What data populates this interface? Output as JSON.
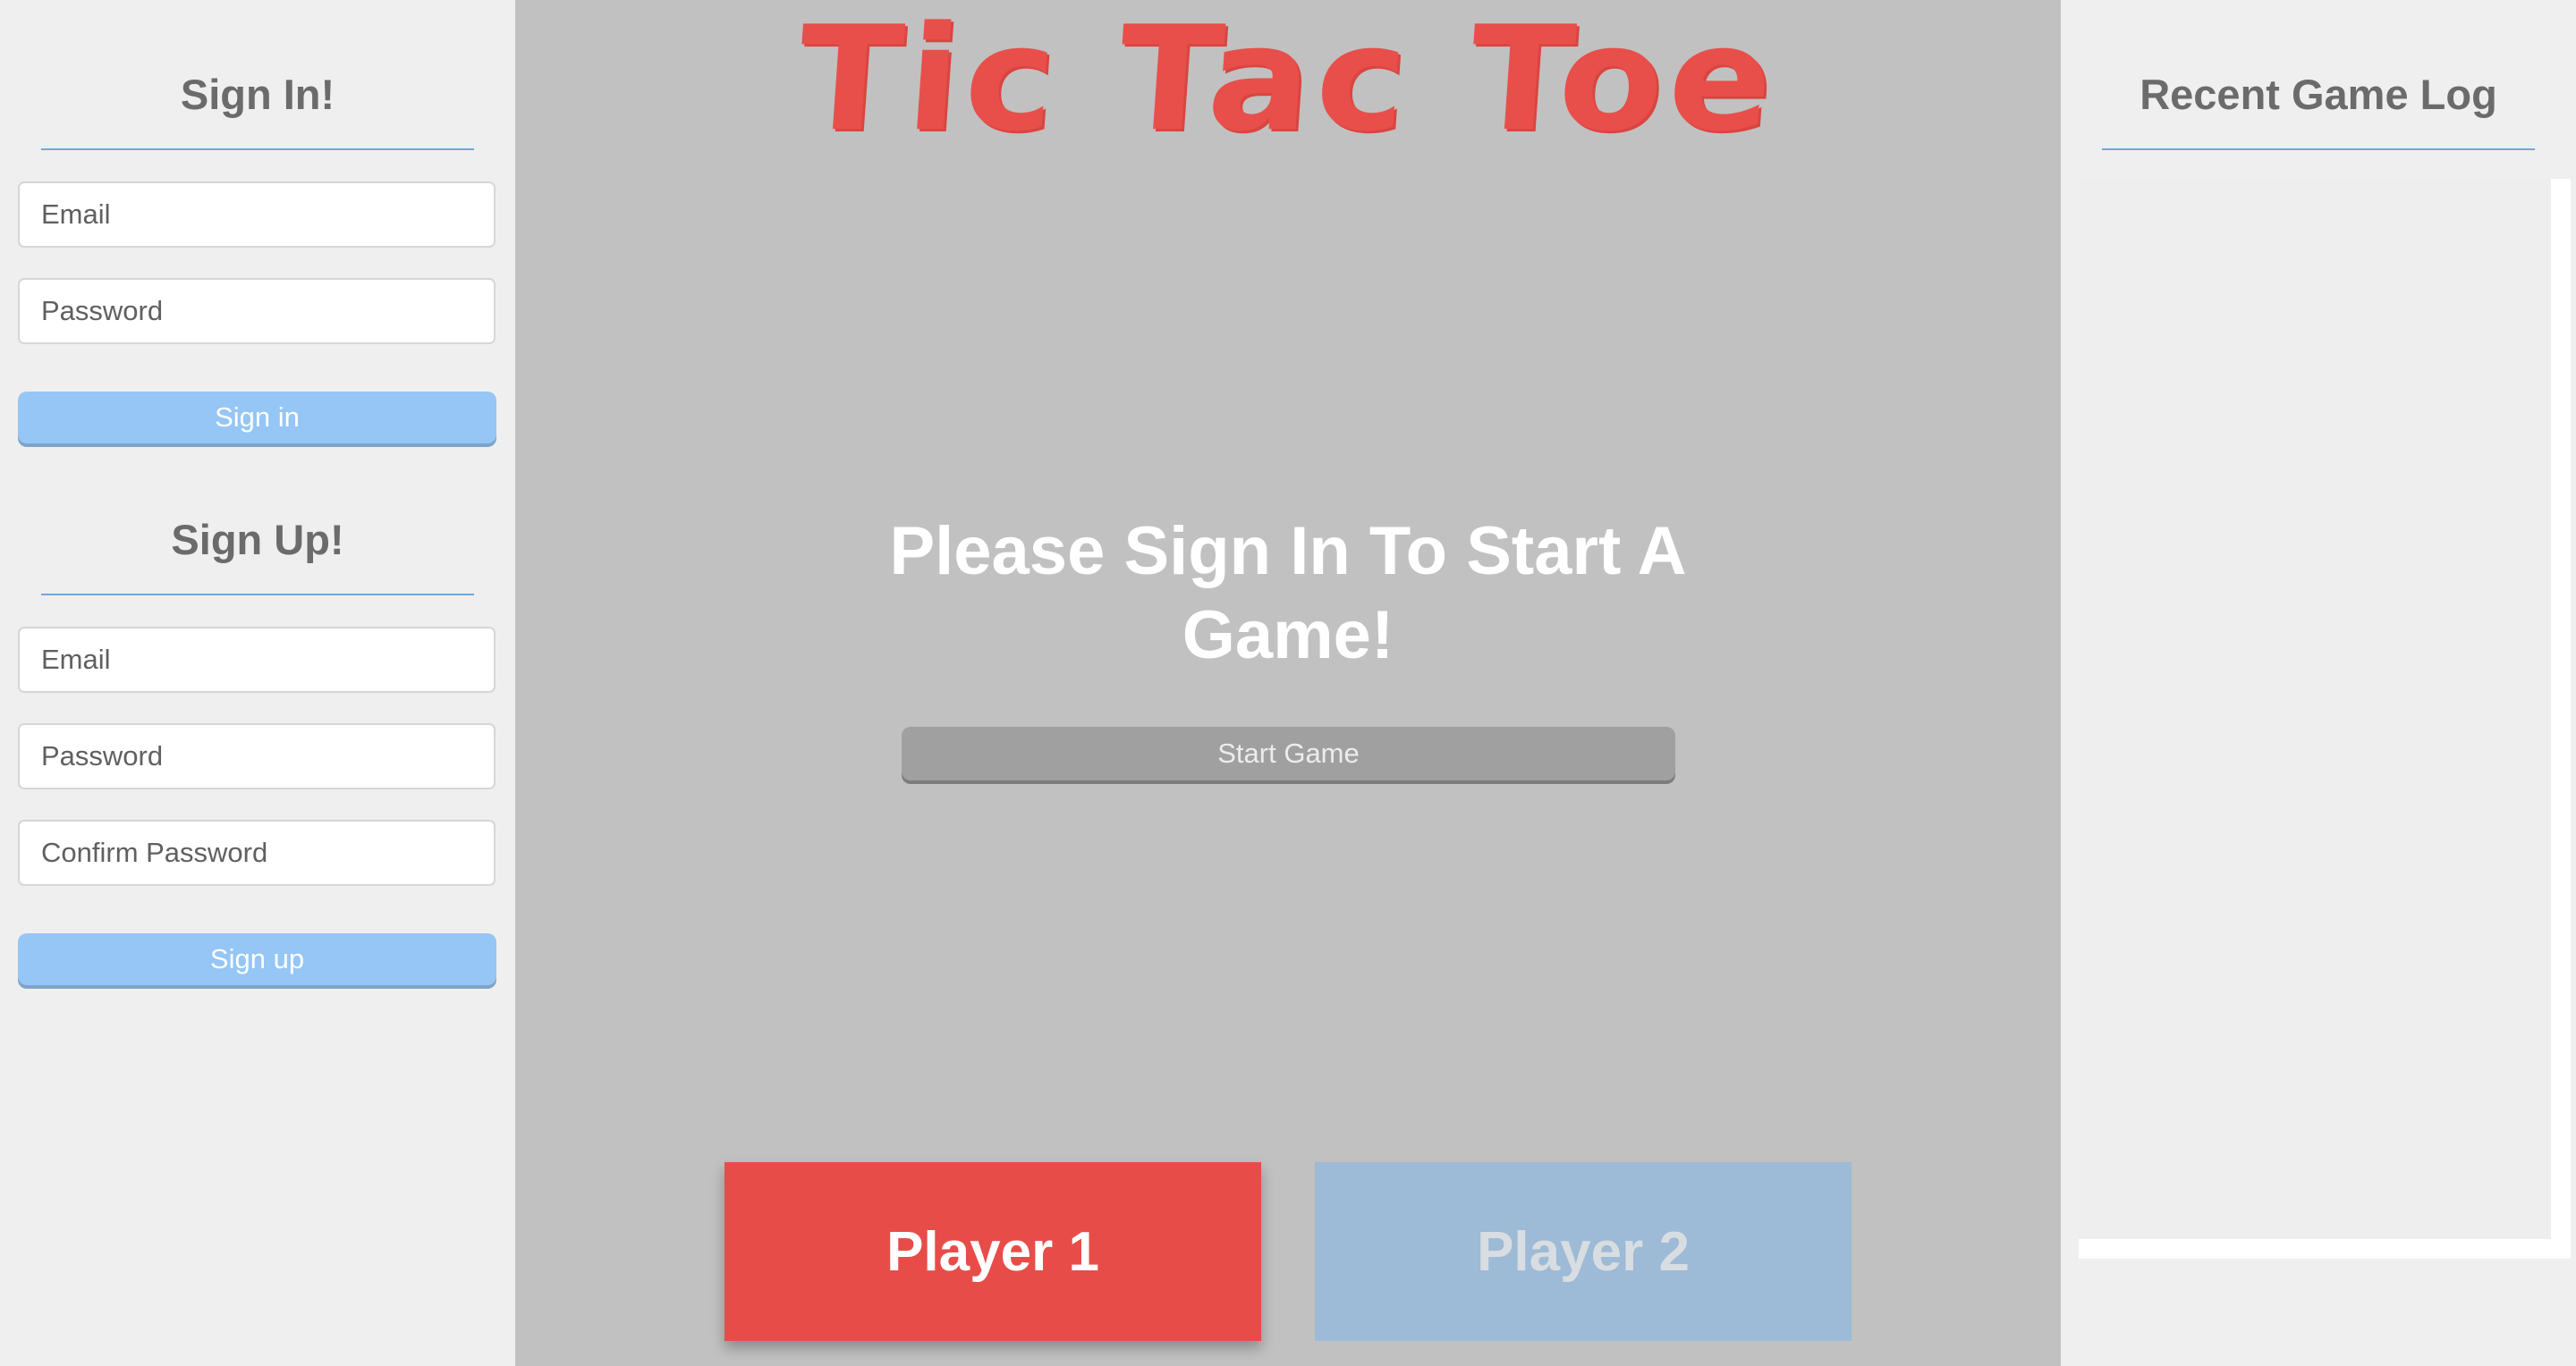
{
  "sign_in": {
    "heading": "Sign In!",
    "email_placeholder": "Email",
    "password_placeholder": "Password",
    "button_label": "Sign in"
  },
  "sign_up": {
    "heading": "Sign Up!",
    "email_placeholder": "Email",
    "password_placeholder": "Password",
    "confirm_placeholder": "Confirm Password",
    "button_label": "Sign up"
  },
  "game": {
    "title": "Tic Tac Toe",
    "prompt": "Please Sign In To Start A Game!",
    "start_button_label": "Start Game",
    "player1_label": "Player 1",
    "player2_label": "Player 2"
  },
  "game_log": {
    "heading": "Recent Game Log",
    "entries": []
  },
  "colors": {
    "accent_red": "#e84c49",
    "button_blue": "#95c6f5",
    "divider_blue": "#6fa8dc",
    "board_gray": "#c1c1c1",
    "player2_blue": "#9dbad6"
  }
}
